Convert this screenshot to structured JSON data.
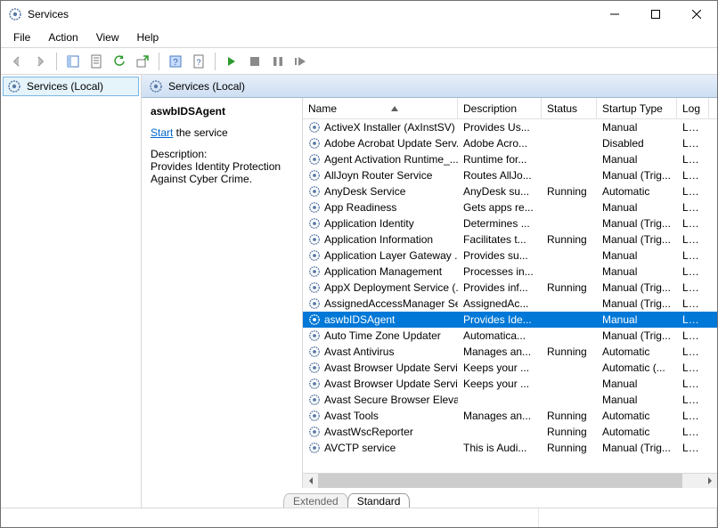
{
  "window": {
    "title": "Services"
  },
  "menu": {
    "file": "File",
    "action": "Action",
    "view": "View",
    "help": "Help"
  },
  "tree": {
    "root": "Services (Local)"
  },
  "pane_header": "Services (Local)",
  "detail": {
    "selected_name": "aswbIDSAgent",
    "start_link": "Start",
    "start_suffix": " the service",
    "desc_head": "Description:",
    "desc_body": "Provides Identity Protection Against Cyber Crime."
  },
  "columns": {
    "name": "Name",
    "desc": "Description",
    "status": "Status",
    "startup": "Startup Type",
    "logon": "Log"
  },
  "rows": [
    {
      "name": "ActiveX Installer (AxInstSV)",
      "desc": "Provides Us...",
      "status": "",
      "startup": "Manual",
      "logon": "Loca",
      "selected": false
    },
    {
      "name": "Adobe Acrobat Update Serv...",
      "desc": "Adobe Acro...",
      "status": "",
      "startup": "Disabled",
      "logon": "Loca",
      "selected": false
    },
    {
      "name": "Agent Activation Runtime_...",
      "desc": "Runtime for...",
      "status": "",
      "startup": "Manual",
      "logon": "Loca",
      "selected": false
    },
    {
      "name": "AllJoyn Router Service",
      "desc": "Routes AllJo...",
      "status": "",
      "startup": "Manual (Trig...",
      "logon": "Loca",
      "selected": false
    },
    {
      "name": "AnyDesk Service",
      "desc": "AnyDesk su...",
      "status": "Running",
      "startup": "Automatic",
      "logon": "Loca",
      "selected": false
    },
    {
      "name": "App Readiness",
      "desc": "Gets apps re...",
      "status": "",
      "startup": "Manual",
      "logon": "Loca",
      "selected": false
    },
    {
      "name": "Application Identity",
      "desc": "Determines ...",
      "status": "",
      "startup": "Manual (Trig...",
      "logon": "Loca",
      "selected": false
    },
    {
      "name": "Application Information",
      "desc": "Facilitates t...",
      "status": "Running",
      "startup": "Manual (Trig...",
      "logon": "Loca",
      "selected": false
    },
    {
      "name": "Application Layer Gateway ...",
      "desc": "Provides su...",
      "status": "",
      "startup": "Manual",
      "logon": "Loca",
      "selected": false
    },
    {
      "name": "Application Management",
      "desc": "Processes in...",
      "status": "",
      "startup": "Manual",
      "logon": "Loca",
      "selected": false
    },
    {
      "name": "AppX Deployment Service (...",
      "desc": "Provides inf...",
      "status": "Running",
      "startup": "Manual (Trig...",
      "logon": "Loca",
      "selected": false
    },
    {
      "name": "AssignedAccessManager Se...",
      "desc": "AssignedAc...",
      "status": "",
      "startup": "Manual (Trig...",
      "logon": "Loca",
      "selected": false
    },
    {
      "name": "aswbIDSAgent",
      "desc": "Provides Ide...",
      "status": "",
      "startup": "Manual",
      "logon": "Loca",
      "selected": true
    },
    {
      "name": "Auto Time Zone Updater",
      "desc": "Automatica...",
      "status": "",
      "startup": "Manual (Trig...",
      "logon": "Loca",
      "selected": false
    },
    {
      "name": "Avast Antivirus",
      "desc": "Manages an...",
      "status": "Running",
      "startup": "Automatic",
      "logon": "Loca",
      "selected": false
    },
    {
      "name": "Avast Browser Update Servi...",
      "desc": "Keeps your ...",
      "status": "",
      "startup": "Automatic (...",
      "logon": "Loca",
      "selected": false
    },
    {
      "name": "Avast Browser Update Servi...",
      "desc": "Keeps your ...",
      "status": "",
      "startup": "Manual",
      "logon": "Loca",
      "selected": false
    },
    {
      "name": "Avast Secure Browser Elevat...",
      "desc": "",
      "status": "",
      "startup": "Manual",
      "logon": "Loca",
      "selected": false
    },
    {
      "name": "Avast Tools",
      "desc": "Manages an...",
      "status": "Running",
      "startup": "Automatic",
      "logon": "Loca",
      "selected": false
    },
    {
      "name": "AvastWscReporter",
      "desc": "",
      "status": "Running",
      "startup": "Automatic",
      "logon": "Loca",
      "selected": false
    },
    {
      "name": "AVCTP service",
      "desc": "This is Audi...",
      "status": "Running",
      "startup": "Manual (Trig...",
      "logon": "Loca",
      "selected": false
    }
  ],
  "tabs": {
    "extended": "Extended",
    "standard": "Standard"
  }
}
